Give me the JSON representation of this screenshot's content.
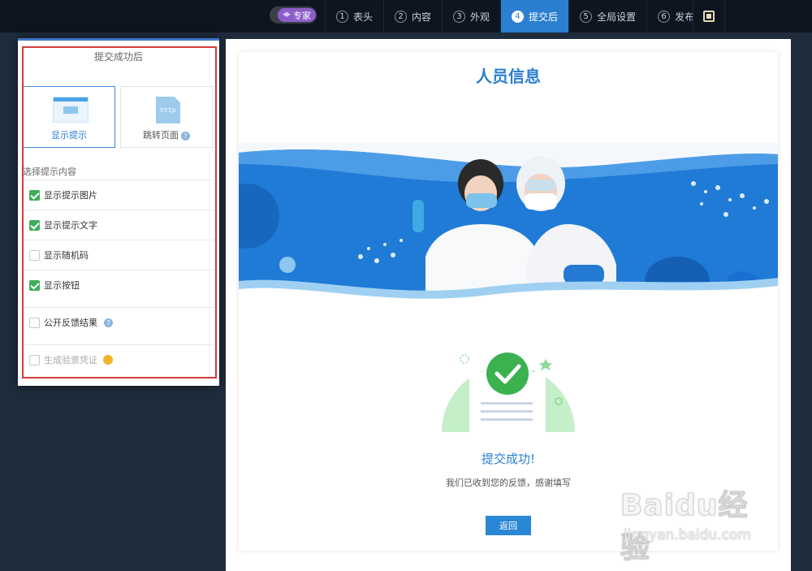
{
  "topbar": {
    "mode_label": "专家",
    "steps": [
      {
        "num": "1",
        "label": "表头"
      },
      {
        "num": "2",
        "label": "内容"
      },
      {
        "num": "3",
        "label": "外观"
      },
      {
        "num": "4",
        "label": "提交后"
      },
      {
        "num": "5",
        "label": "全局设置"
      },
      {
        "num": "6",
        "label": "发布"
      }
    ],
    "active_step": 4
  },
  "panel": {
    "title": "提交成功后",
    "option_show_tip": "显示提示",
    "option_redirect": "跳转页面",
    "http_icon_text": "http",
    "help_mark": "?",
    "section_label": "选择提示内容",
    "checks": [
      {
        "label": "显示提示图片",
        "checked": true
      },
      {
        "label": "显示提示文字",
        "checked": true
      },
      {
        "label": "显示随机码",
        "checked": false
      },
      {
        "label": "显示按钮",
        "checked": true
      },
      {
        "label": "公开反馈结果",
        "checked": false
      },
      {
        "label": "生成验票凭证",
        "checked": false,
        "disabled": true
      }
    ]
  },
  "preview": {
    "title": "人员信息",
    "success_title": "提交成功!",
    "success_sub": "我们已收到您的反馈，感谢填写",
    "back_button": "返回"
  },
  "watermark": {
    "main": "Baidu经验",
    "sub": "jingyan.baidu.com"
  },
  "colors": {
    "accent": "#2a7fd0",
    "checked": "#3fae5a",
    "outline": "#d23b3b",
    "topbar": "#0e1520"
  }
}
